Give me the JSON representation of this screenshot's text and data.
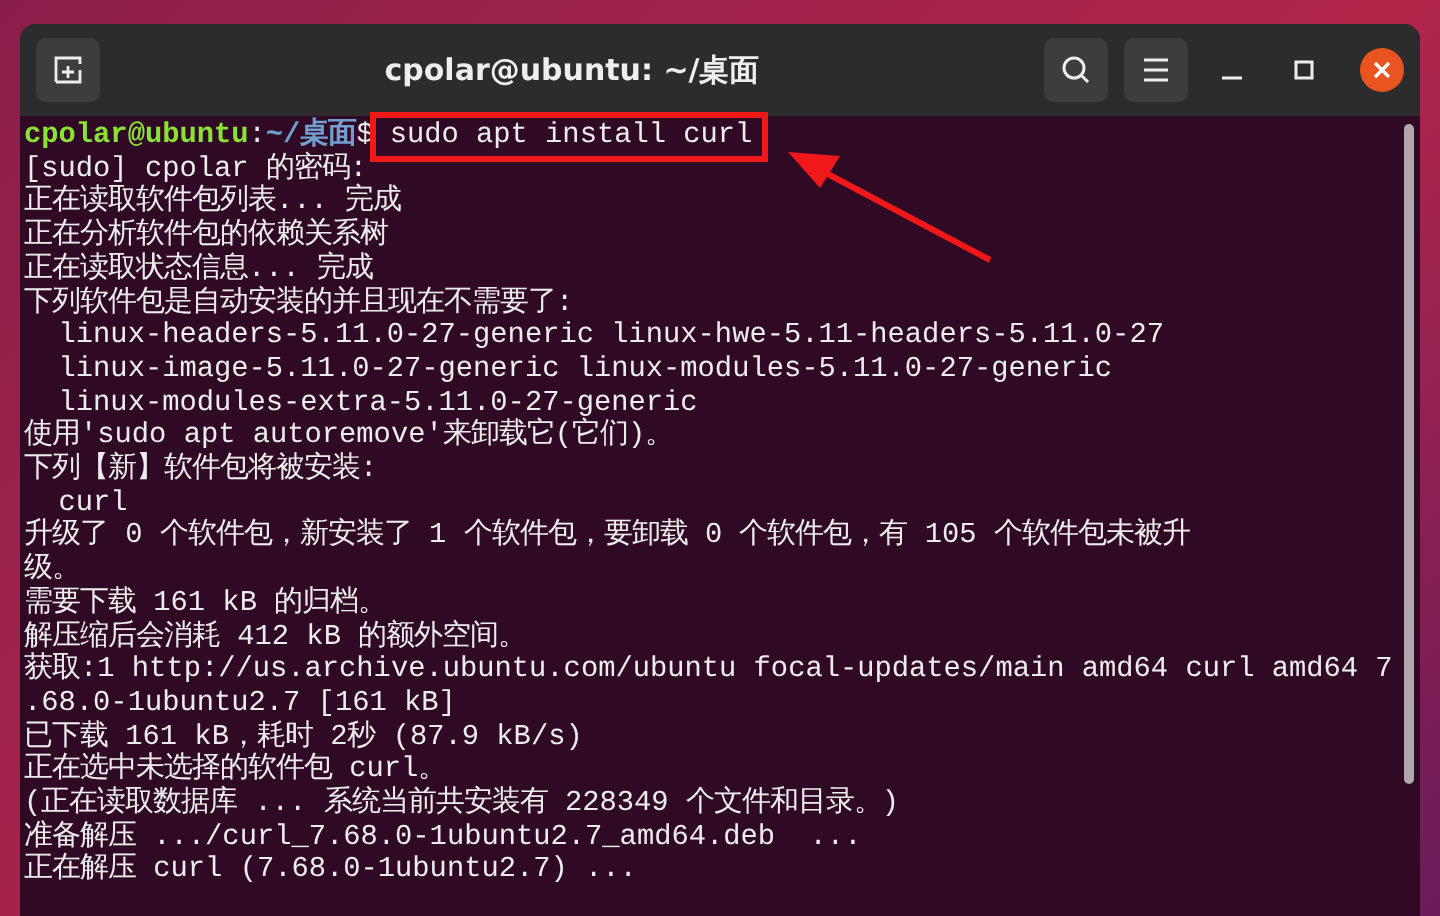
{
  "window": {
    "title": "cpolar@ubuntu: ~/桌面"
  },
  "prompt": {
    "user_host": "cpolar@ubuntu",
    "separator": ":",
    "path": "~/桌面",
    "symbol": "$",
    "command": "sudo apt install curl"
  },
  "lines": [
    "[sudo] cpolar 的密码:",
    "正在读取软件包列表... 完成",
    "正在分析软件包的依赖关系树",
    "正在读取状态信息... 完成",
    "下列软件包是自动安装的并且现在不需要了:",
    "  linux-headers-5.11.0-27-generic linux-hwe-5.11-headers-5.11.0-27",
    "  linux-image-5.11.0-27-generic linux-modules-5.11.0-27-generic",
    "  linux-modules-extra-5.11.0-27-generic",
    "使用'sudo apt autoremove'来卸载它(它们)。",
    "下列【新】软件包将被安装:",
    "  curl",
    "升级了 0 个软件包，新安装了 1 个软件包，要卸载 0 个软件包，有 105 个软件包未被升",
    "级。",
    "需要下载 161 kB 的归档。",
    "解压缩后会消耗 412 kB 的额外空间。",
    "获取:1 http://us.archive.ubuntu.com/ubuntu focal-updates/main amd64 curl amd64 7",
    ".68.0-1ubuntu2.7 [161 kB]",
    "已下载 161 kB，耗时 2秒 (87.9 kB/s)",
    "正在选中未选择的软件包 curl。",
    "(正在读取数据库 ... 系统当前共安装有 228349 个文件和目录。)",
    "准备解压 .../curl_7.68.0-1ubuntu2.7_amd64.deb  ...",
    "正在解压 curl (7.68.0-1ubuntu2.7) ..."
  ]
}
